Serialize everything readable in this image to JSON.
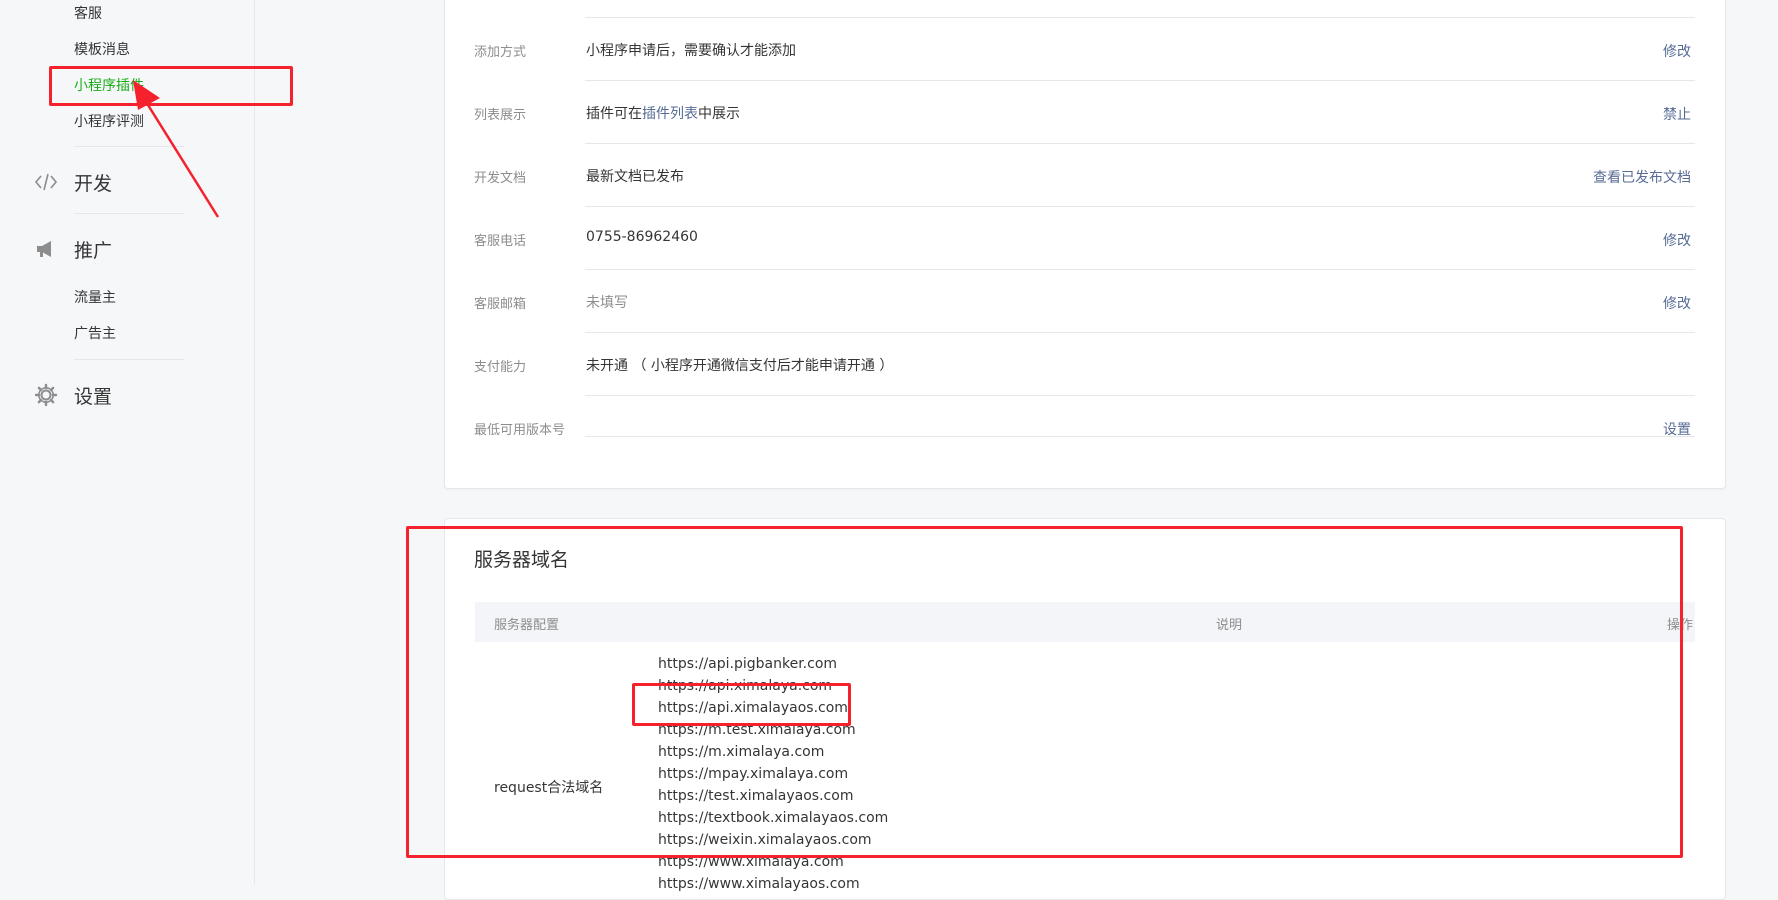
{
  "sidebar": {
    "top_items": [
      "客服",
      "模板消息",
      "小程序插件",
      "小程序评测"
    ],
    "active_item": "小程序插件",
    "sections": [
      {
        "icon": "code-icon",
        "label": "开发",
        "items": []
      },
      {
        "icon": "megaphone-icon",
        "label": "推广",
        "items": [
          "流量主",
          "广告主"
        ]
      },
      {
        "icon": "gear-icon",
        "label": "设置",
        "items": []
      }
    ]
  },
  "plugin_settings": {
    "rows": [
      {
        "label": "添加方式",
        "value": "小程序申请后，需要确认才能添加",
        "action": "修改"
      },
      {
        "label": "列表展示",
        "value_prefix": "插件可在",
        "value_link": "插件列表",
        "value_suffix": "中展示",
        "action": "禁止"
      },
      {
        "label": "开发文档",
        "value": "最新文档已发布",
        "action": "查看已发布文档"
      },
      {
        "label": "客服电话",
        "value": "0755-86962460",
        "action": "修改"
      },
      {
        "label": "客服邮箱",
        "value": "未填写",
        "action": "修改"
      },
      {
        "label": "支付能力",
        "value": "未开通 （ 小程序开通微信支付后才能申请开通 ）",
        "action": ""
      },
      {
        "label": "最低可用版本号",
        "value": "",
        "action": "设置"
      }
    ]
  },
  "server_domain": {
    "title": "服务器域名",
    "columns": [
      "服务器配置",
      "说明",
      "操作"
    ],
    "request_label": "request合法域名",
    "domains": [
      "https://api.pigbanker.com",
      "https://api.ximalaya.com",
      "https://api.ximalayaos.com",
      "https://m.test.ximalaya.com",
      "https://m.ximalaya.com",
      "https://mpay.ximalaya.com",
      "https://test.ximalayaos.com",
      "https://textbook.ximalayaos.com",
      "https://weixin.ximalayaos.com",
      "https://www.ximalaya.com",
      "https://www.ximalayaos.com"
    ]
  },
  "colors": {
    "accent_green": "#1aad19",
    "link_blue": "#576b95",
    "annotation_red": "#f5222d"
  }
}
